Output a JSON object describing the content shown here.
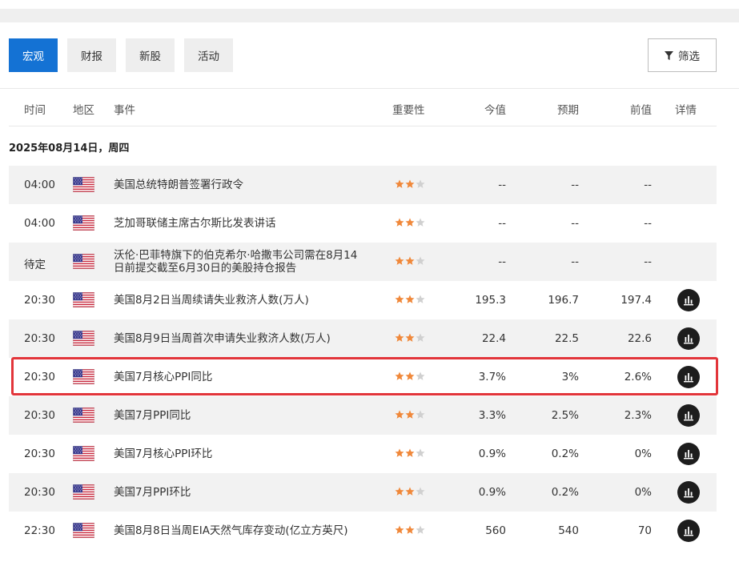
{
  "tabs": [
    {
      "label": "宏观",
      "active": true
    },
    {
      "label": "财报",
      "active": false
    },
    {
      "label": "新股",
      "active": false
    },
    {
      "label": "活动",
      "active": false
    }
  ],
  "filter": {
    "label": "筛选",
    "icon": "filter-icon"
  },
  "columns": {
    "time": "时间",
    "region": "地区",
    "event": "事件",
    "importance": "重要性",
    "actual": "今值",
    "forecast": "预期",
    "previous": "前值",
    "detail": "详情"
  },
  "date_heading": "2025年08月14日，周四",
  "colors": {
    "accent": "#1472d4",
    "star_on": "#f0883a",
    "star_off": "#d0d0d0",
    "highlight": "#e2353a"
  },
  "rows": [
    {
      "time": "04:00",
      "flag": "us-flag",
      "event": "美国总统特朗普签署行政令",
      "stars": 2,
      "actual": "--",
      "forecast": "--",
      "previous": "--",
      "has_detail": false
    },
    {
      "time": "04:00",
      "flag": "us-flag",
      "event": "芝加哥联储主席古尔斯比发表讲话",
      "stars": 2,
      "actual": "--",
      "forecast": "--",
      "previous": "--",
      "has_detail": false
    },
    {
      "time": "待定",
      "flag": "us-flag",
      "event": "沃伦·巴菲特旗下的伯克希尔·哈撒韦公司需在8月14日前提交截至6月30日的美股持仓报告",
      "stars": 2,
      "actual": "--",
      "forecast": "--",
      "previous": "--",
      "has_detail": false
    },
    {
      "time": "20:30",
      "flag": "us-flag",
      "event": "美国8月2日当周续请失业救济人数(万人)",
      "stars": 2,
      "actual": "195.3",
      "forecast": "196.7",
      "previous": "197.4",
      "has_detail": true
    },
    {
      "time": "20:30",
      "flag": "us-flag",
      "event": "美国8月9日当周首次申请失业救济人数(万人)",
      "stars": 2,
      "actual": "22.4",
      "forecast": "22.5",
      "previous": "22.6",
      "has_detail": true
    },
    {
      "time": "20:30",
      "flag": "us-flag",
      "event": "美国7月核心PPI同比",
      "stars": 2,
      "actual": "3.7%",
      "forecast": "3%",
      "previous": "2.6%",
      "has_detail": true,
      "highlighted": true
    },
    {
      "time": "20:30",
      "flag": "us-flag",
      "event": "美国7月PPI同比",
      "stars": 2,
      "actual": "3.3%",
      "forecast": "2.5%",
      "previous": "2.3%",
      "has_detail": true
    },
    {
      "time": "20:30",
      "flag": "us-flag",
      "event": "美国7月核心PPI环比",
      "stars": 2,
      "actual": "0.9%",
      "forecast": "0.2%",
      "previous": "0%",
      "has_detail": true
    },
    {
      "time": "20:30",
      "flag": "us-flag",
      "event": "美国7月PPI环比",
      "stars": 2,
      "actual": "0.9%",
      "forecast": "0.2%",
      "previous": "0%",
      "has_detail": true
    },
    {
      "time": "22:30",
      "flag": "us-flag",
      "event": "美国8月8日当周EIA天然气库存变动(亿立方英尺)",
      "stars": 2,
      "actual": "560",
      "forecast": "540",
      "previous": "70",
      "has_detail": true
    }
  ]
}
